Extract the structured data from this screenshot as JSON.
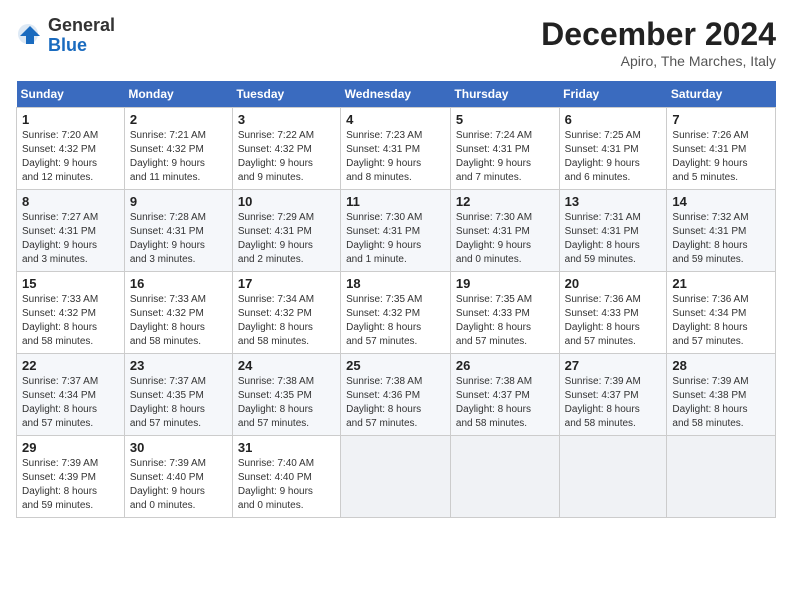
{
  "header": {
    "logo_general": "General",
    "logo_blue": "Blue",
    "month_title": "December 2024",
    "location": "Apiro, The Marches, Italy"
  },
  "days_of_week": [
    "Sunday",
    "Monday",
    "Tuesday",
    "Wednesday",
    "Thursday",
    "Friday",
    "Saturday"
  ],
  "weeks": [
    [
      {
        "day": 1,
        "info": "Sunrise: 7:20 AM\nSunset: 4:32 PM\nDaylight: 9 hours\nand 12 minutes."
      },
      {
        "day": 2,
        "info": "Sunrise: 7:21 AM\nSunset: 4:32 PM\nDaylight: 9 hours\nand 11 minutes."
      },
      {
        "day": 3,
        "info": "Sunrise: 7:22 AM\nSunset: 4:32 PM\nDaylight: 9 hours\nand 9 minutes."
      },
      {
        "day": 4,
        "info": "Sunrise: 7:23 AM\nSunset: 4:31 PM\nDaylight: 9 hours\nand 8 minutes."
      },
      {
        "day": 5,
        "info": "Sunrise: 7:24 AM\nSunset: 4:31 PM\nDaylight: 9 hours\nand 7 minutes."
      },
      {
        "day": 6,
        "info": "Sunrise: 7:25 AM\nSunset: 4:31 PM\nDaylight: 9 hours\nand 6 minutes."
      },
      {
        "day": 7,
        "info": "Sunrise: 7:26 AM\nSunset: 4:31 PM\nDaylight: 9 hours\nand 5 minutes."
      }
    ],
    [
      {
        "day": 8,
        "info": "Sunrise: 7:27 AM\nSunset: 4:31 PM\nDaylight: 9 hours\nand 3 minutes."
      },
      {
        "day": 9,
        "info": "Sunrise: 7:28 AM\nSunset: 4:31 PM\nDaylight: 9 hours\nand 3 minutes."
      },
      {
        "day": 10,
        "info": "Sunrise: 7:29 AM\nSunset: 4:31 PM\nDaylight: 9 hours\nand 2 minutes."
      },
      {
        "day": 11,
        "info": "Sunrise: 7:30 AM\nSunset: 4:31 PM\nDaylight: 9 hours\nand 1 minute."
      },
      {
        "day": 12,
        "info": "Sunrise: 7:30 AM\nSunset: 4:31 PM\nDaylight: 9 hours\nand 0 minutes."
      },
      {
        "day": 13,
        "info": "Sunrise: 7:31 AM\nSunset: 4:31 PM\nDaylight: 8 hours\nand 59 minutes."
      },
      {
        "day": 14,
        "info": "Sunrise: 7:32 AM\nSunset: 4:31 PM\nDaylight: 8 hours\nand 59 minutes."
      }
    ],
    [
      {
        "day": 15,
        "info": "Sunrise: 7:33 AM\nSunset: 4:32 PM\nDaylight: 8 hours\nand 58 minutes."
      },
      {
        "day": 16,
        "info": "Sunrise: 7:33 AM\nSunset: 4:32 PM\nDaylight: 8 hours\nand 58 minutes."
      },
      {
        "day": 17,
        "info": "Sunrise: 7:34 AM\nSunset: 4:32 PM\nDaylight: 8 hours\nand 58 minutes."
      },
      {
        "day": 18,
        "info": "Sunrise: 7:35 AM\nSunset: 4:32 PM\nDaylight: 8 hours\nand 57 minutes."
      },
      {
        "day": 19,
        "info": "Sunrise: 7:35 AM\nSunset: 4:33 PM\nDaylight: 8 hours\nand 57 minutes."
      },
      {
        "day": 20,
        "info": "Sunrise: 7:36 AM\nSunset: 4:33 PM\nDaylight: 8 hours\nand 57 minutes."
      },
      {
        "day": 21,
        "info": "Sunrise: 7:36 AM\nSunset: 4:34 PM\nDaylight: 8 hours\nand 57 minutes."
      }
    ],
    [
      {
        "day": 22,
        "info": "Sunrise: 7:37 AM\nSunset: 4:34 PM\nDaylight: 8 hours\nand 57 minutes."
      },
      {
        "day": 23,
        "info": "Sunrise: 7:37 AM\nSunset: 4:35 PM\nDaylight: 8 hours\nand 57 minutes."
      },
      {
        "day": 24,
        "info": "Sunrise: 7:38 AM\nSunset: 4:35 PM\nDaylight: 8 hours\nand 57 minutes."
      },
      {
        "day": 25,
        "info": "Sunrise: 7:38 AM\nSunset: 4:36 PM\nDaylight: 8 hours\nand 57 minutes."
      },
      {
        "day": 26,
        "info": "Sunrise: 7:38 AM\nSunset: 4:37 PM\nDaylight: 8 hours\nand 58 minutes."
      },
      {
        "day": 27,
        "info": "Sunrise: 7:39 AM\nSunset: 4:37 PM\nDaylight: 8 hours\nand 58 minutes."
      },
      {
        "day": 28,
        "info": "Sunrise: 7:39 AM\nSunset: 4:38 PM\nDaylight: 8 hours\nand 58 minutes."
      }
    ],
    [
      {
        "day": 29,
        "info": "Sunrise: 7:39 AM\nSunset: 4:39 PM\nDaylight: 8 hours\nand 59 minutes."
      },
      {
        "day": 30,
        "info": "Sunrise: 7:39 AM\nSunset: 4:40 PM\nDaylight: 9 hours\nand 0 minutes."
      },
      {
        "day": 31,
        "info": "Sunrise: 7:40 AM\nSunset: 4:40 PM\nDaylight: 9 hours\nand 0 minutes."
      },
      null,
      null,
      null,
      null
    ]
  ]
}
